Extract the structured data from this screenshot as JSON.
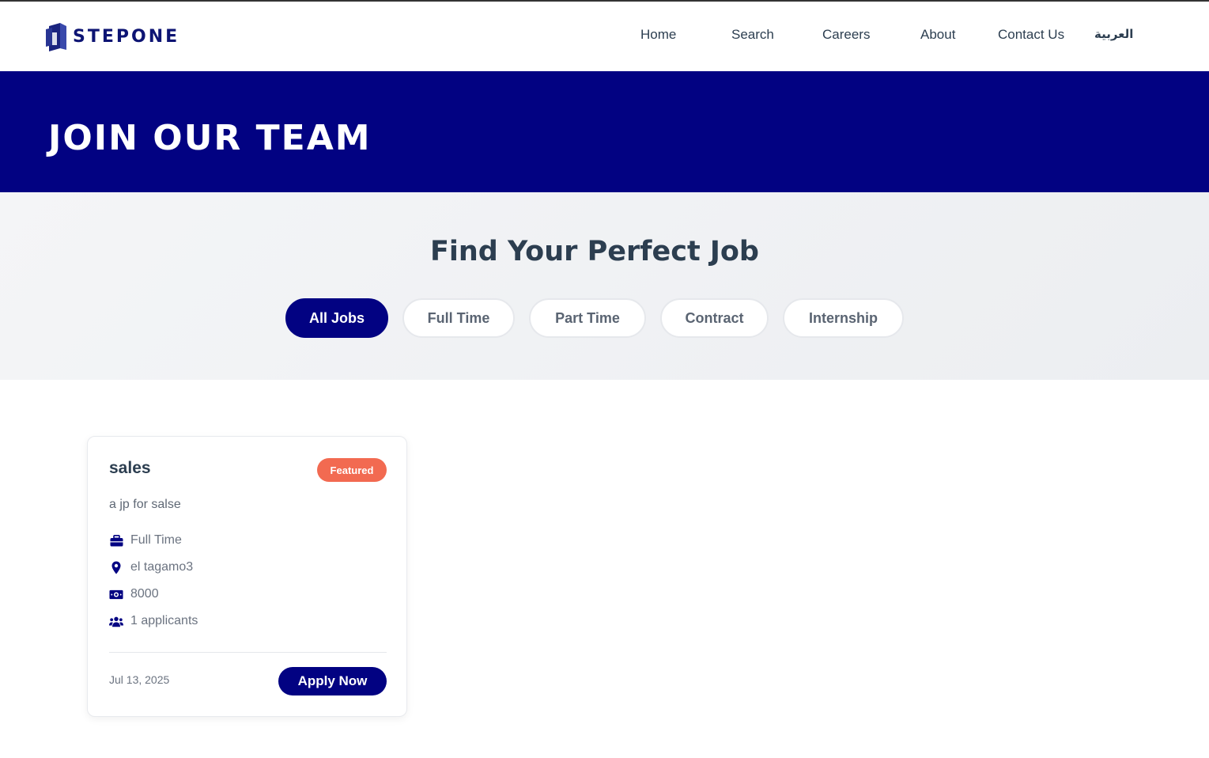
{
  "brand": {
    "name": "STEPONE",
    "color": "#0d1473"
  },
  "nav": {
    "home": "Home",
    "search": "Search",
    "careers": "Careers",
    "about": "About",
    "contact": "Contact Us",
    "language": "العربية"
  },
  "hero": {
    "title": "JOIN OUR TEAM",
    "background": "#020282"
  },
  "filters": {
    "title": "Find Your Perfect Job",
    "options": [
      "All Jobs",
      "Full Time",
      "Part Time",
      "Contract",
      "Internship"
    ],
    "selected": "All Jobs"
  },
  "jobs": [
    {
      "title": "sales",
      "badge": "Featured",
      "description": "a jp for salse",
      "type": "Full Time",
      "location": "el tagamo3",
      "salary": "8000",
      "applicants": "1 applicants",
      "date": "Jul 13, 2025",
      "apply_label": "Apply Now",
      "icons": [
        "briefcase-icon",
        "map-pin-icon",
        "money-icon",
        "users-icon"
      ]
    }
  ],
  "colors": {
    "accent": "#020282",
    "badge": "#f26a51",
    "text": "#2c3e50"
  }
}
